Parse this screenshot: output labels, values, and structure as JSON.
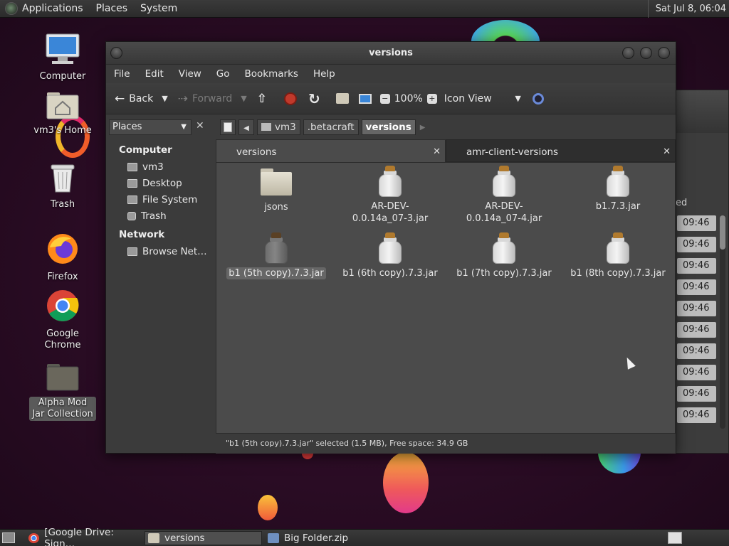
{
  "top_panel": {
    "menus": [
      "Applications",
      "Places",
      "System"
    ],
    "clock": "Sat Jul  8, 06:04"
  },
  "desktop": {
    "icons": [
      {
        "label": "Computer",
        "icon": "computer-icon"
      },
      {
        "label": "vm3's Home",
        "icon": "home-folder-icon"
      },
      {
        "label": "Trash",
        "icon": "trash-icon"
      },
      {
        "label": "Firefox",
        "icon": "firefox-icon"
      },
      {
        "label": "Google Chrome",
        "icon": "chrome-icon"
      },
      {
        "label": "Alpha Mod Jar Collection",
        "icon": "folder-icon"
      }
    ]
  },
  "window": {
    "title": "versions",
    "menu": [
      "File",
      "Edit",
      "View",
      "Go",
      "Bookmarks",
      "Help"
    ],
    "toolbar": {
      "back": "Back",
      "forward": "Forward",
      "zoom": "100%",
      "view_mode": "Icon View"
    },
    "places_combo": "Places",
    "breadcrumbs": [
      "vm3",
      ".betacraft",
      "versions"
    ],
    "sidebar": {
      "computer_header": "Computer",
      "computer_items": [
        "vm3",
        "Desktop",
        "File System",
        "Trash"
      ],
      "network_header": "Network",
      "network_items": [
        "Browse Net…"
      ]
    },
    "tabs": [
      {
        "label": "versions",
        "active": true
      },
      {
        "label": "amr-client-versions",
        "active": false
      }
    ],
    "files": [
      {
        "name": "jsons",
        "type": "folder"
      },
      {
        "name": "AR-DEV-0.0.14a_07-3.jar",
        "type": "jar"
      },
      {
        "name": "AR-DEV-0.0.14a_07-4.jar",
        "type": "jar"
      },
      {
        "name": "b1.7.3.jar",
        "type": "jar"
      },
      {
        "name": "b1 (5th copy).7.3.jar",
        "type": "jar",
        "selected": true
      },
      {
        "name": "b1 (6th copy).7.3.jar",
        "type": "jar"
      },
      {
        "name": "b1 (7th copy).7.3.jar",
        "type": "jar"
      },
      {
        "name": "b1 (8th copy).7.3.jar",
        "type": "jar"
      }
    ],
    "status": "\"b1 (5th copy).7.3.jar\" selected (1.5 MB), Free space: 34.9 GB"
  },
  "background_window": {
    "column_header_fragment": "ed",
    "times": [
      "09:46",
      "09:46",
      "09:46",
      "09:46",
      "09:46",
      "09:46",
      "09:46",
      "09:46",
      "09:46",
      "09:46"
    ]
  },
  "taskbar": {
    "items": [
      "[Google Drive: Sign…",
      "versions",
      "Big Folder.zip"
    ]
  },
  "colors": {
    "panel": "#2b2b2b",
    "window_bg": "#3b3b3b",
    "icon_view_bg": "#4b4b4b",
    "wallpaper": "#2a0c24"
  }
}
